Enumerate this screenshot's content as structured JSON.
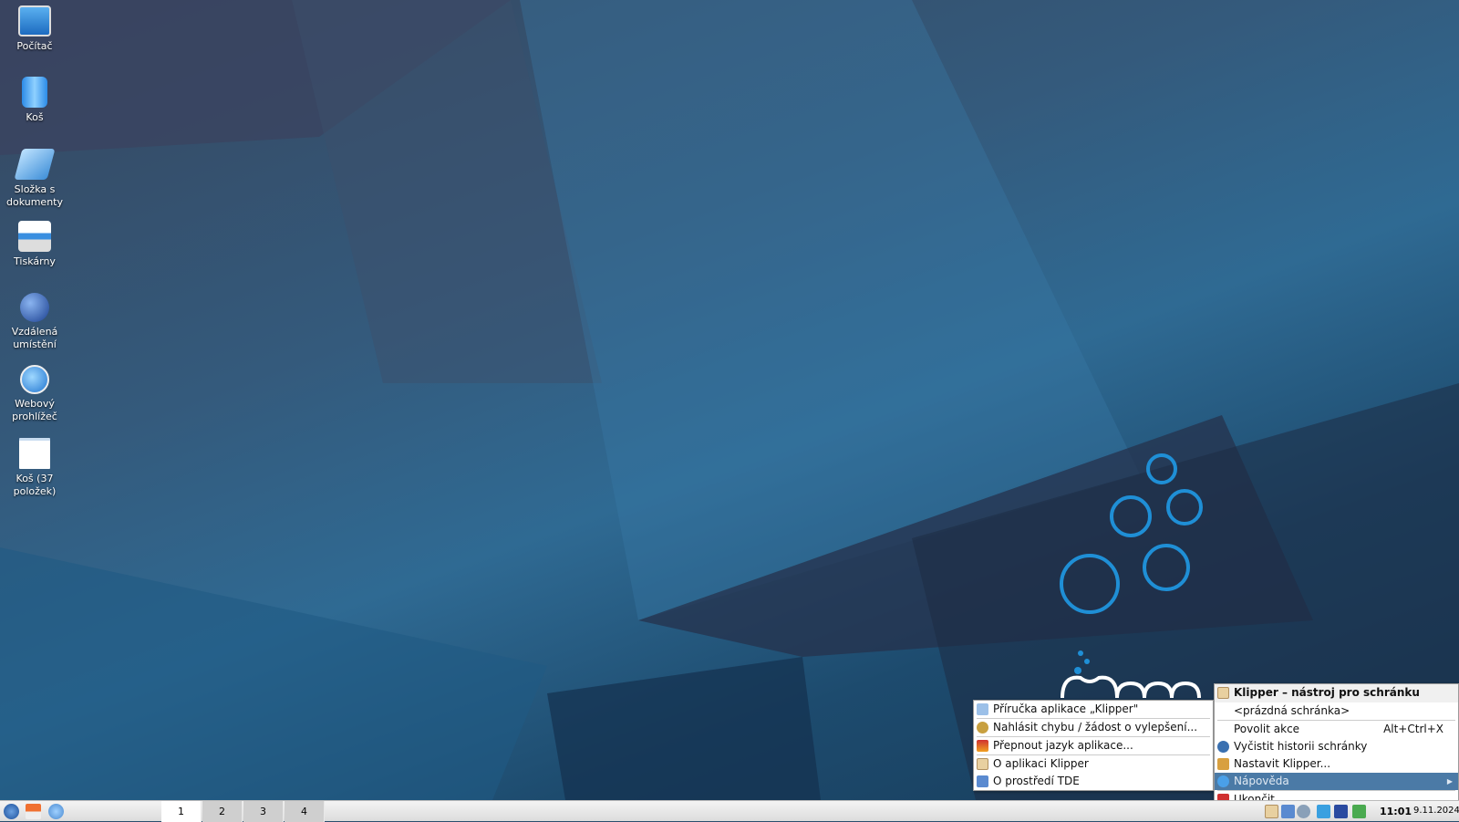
{
  "desktop_icons": [
    {
      "label": "Počítač",
      "icon": "computer-icon"
    },
    {
      "label": "Koš",
      "icon": "trash-icon"
    },
    {
      "label": "Složka s dokumenty",
      "icon": "documents-folder-icon"
    },
    {
      "label": "Tiskárny",
      "icon": "printer-icon"
    },
    {
      "label": "Vzdálená umístění",
      "icon": "network-globe-icon"
    },
    {
      "label": "Webový prohlížeč",
      "icon": "web-browser-icon"
    },
    {
      "label": "Koš (37 položek)",
      "icon": "trash-full-icon"
    }
  ],
  "klipper_menu": {
    "title": "Klipper – nástroj pro schránku",
    "items": [
      "<prázdná schránka>",
      "Povolit akce",
      "Vyčistit historii schránky",
      "Nastavit Klipper...",
      "Nápověda",
      "Ukončit"
    ],
    "shortcut": "Alt+Ctrl+X"
  },
  "help_submenu": {
    "items": [
      "Příručka aplikace „Klipper\"",
      "Nahlásit chybu / žádost o vylepšení...",
      "Přepnout jazyk aplikace...",
      "O aplikaci Klipper",
      "O prostředí TDE"
    ]
  },
  "taskbar": {
    "desktops": [
      "1",
      "2",
      "3",
      "4"
    ],
    "time": "11:01",
    "date": "9.11.2024"
  },
  "colors": {
    "accent": "#4b7aa6",
    "logo": "#1f8fd6"
  }
}
